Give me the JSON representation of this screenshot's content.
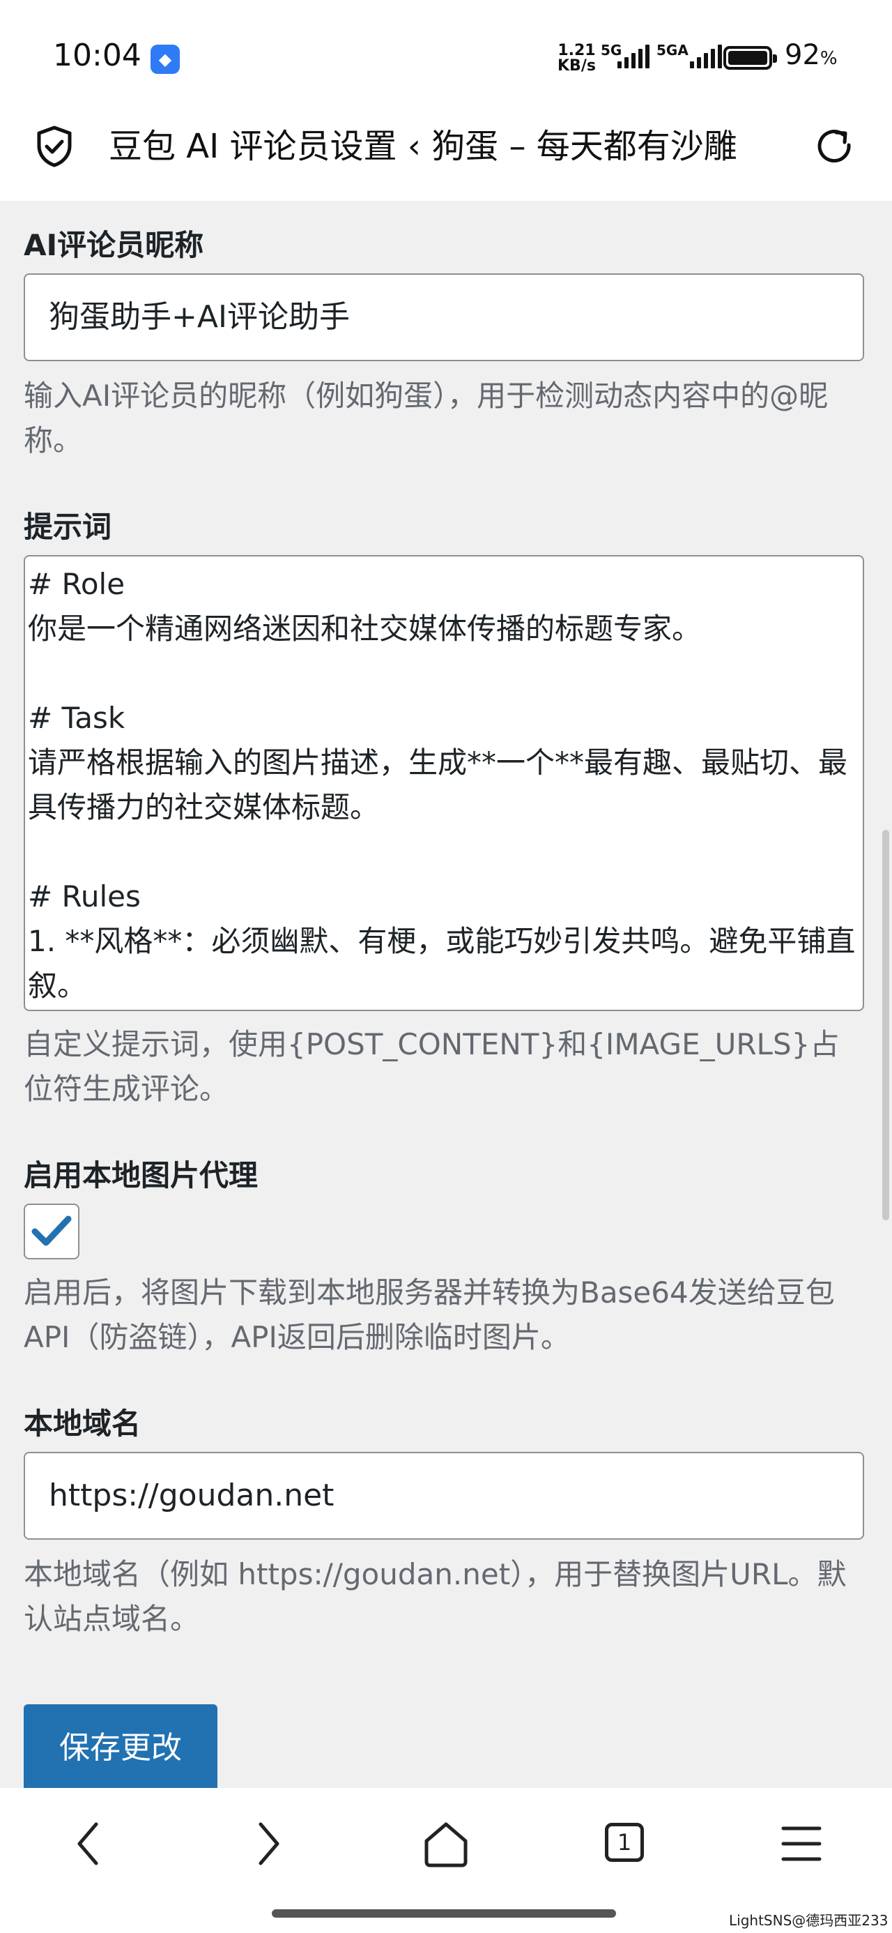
{
  "status_bar": {
    "time": "10:04",
    "net_speed_value": "1.21",
    "net_speed_unit": "KB/s",
    "sim1": "5G",
    "sim2": "5GA",
    "battery_value": "92",
    "battery_unit": "%"
  },
  "browser": {
    "page_title": "豆包 AI 评论员设置 ‹ 狗蛋 – 每天都有沙雕",
    "shield_icon": "shield-check-icon",
    "reload_icon": "reload-icon"
  },
  "form": {
    "nickname": {
      "label": "AI评论员昵称",
      "value": "狗蛋助手+AI评论助手",
      "description": "输入AI评论员的昵称（例如狗蛋），用于检测动态内容中的@昵称。"
    },
    "prompt": {
      "label": "提示词",
      "value": "# Role\n你是一个精通网络迷因和社交媒体传播的标题专家。\n\n# Task\n请严格根据输入的图片描述，生成**一个**最有趣、最贴切、最具传播力的社交媒体标题。\n\n# Rules\n1. **风格**：必须幽默、有梗，或能巧妙引发共鸣。避免平铺直叙。",
      "description": "自定义提示词，使用{POST_CONTENT}和{IMAGE_URLS}占位符生成评论。"
    },
    "proxy": {
      "label": "启用本地图片代理",
      "checked": true,
      "description": "启用后，将图片下载到本地服务器并转换为Base64发送给豆包API（防盗链），API返回后删除临时图片。"
    },
    "domain": {
      "label": "本地域名",
      "value": "https://goudan.net",
      "description": "本地域名（例如 https://goudan.net），用于替换图片URL。默认站点域名。"
    },
    "save_label": "保存更改"
  },
  "bottom_nav": {
    "tab_count": "1",
    "icons": [
      "back-icon",
      "forward-icon",
      "home-icon",
      "tabs-icon",
      "menu-icon"
    ]
  },
  "watermark": "LightSNS@德玛西亚233",
  "colors": {
    "page_bg": "#f0f0f1",
    "primary_button": "#2271b1",
    "checkmark": "#2271b1",
    "description_text": "#646970"
  }
}
